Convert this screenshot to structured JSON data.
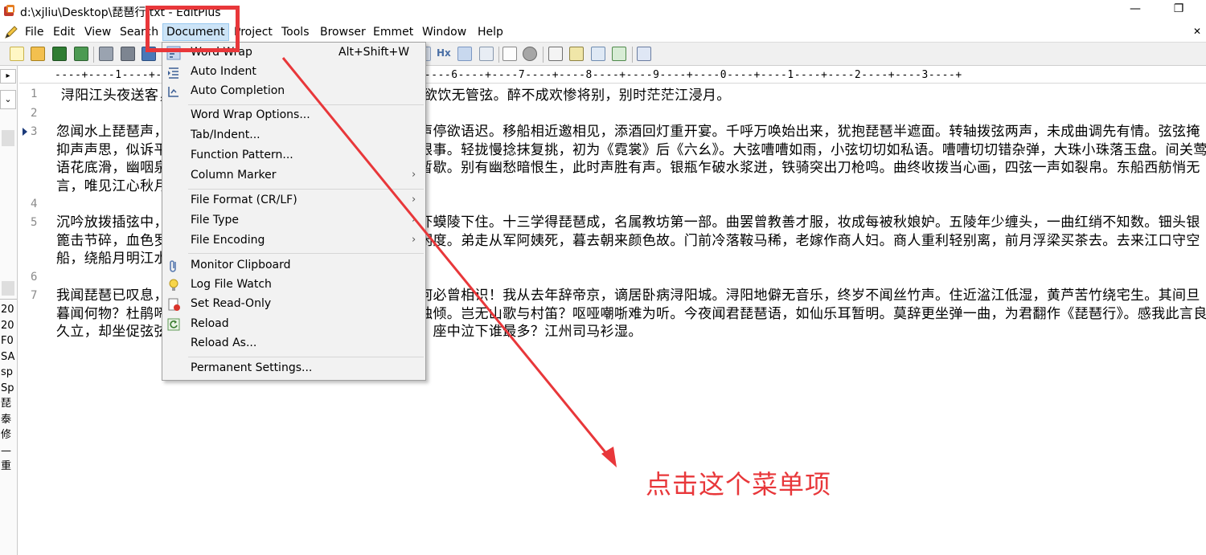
{
  "window": {
    "title": "d:\\xjliu\\Desktop\\琵琶行.txt - EditPlus",
    "minimize_glyph": "—",
    "maximize_glyph": "❐"
  },
  "menubar": {
    "items": [
      "File",
      "Edit",
      "View",
      "Search",
      "Document",
      "Project",
      "Tools",
      "Browser",
      "Emmet",
      "Window",
      "Help"
    ],
    "close_glyph": "✕"
  },
  "document_menu": {
    "items": [
      {
        "label": "Word Wrap",
        "shortcut": "Alt+Shift+W",
        "icon": "word-wrap-icon"
      },
      {
        "label": "Auto Indent",
        "icon": "auto-indent-icon"
      },
      {
        "label": "Auto Completion",
        "icon": "auto-completion-icon"
      },
      {
        "label": "Word Wrap Options..."
      },
      {
        "label": "Tab/Indent..."
      },
      {
        "label": "Function Pattern..."
      },
      {
        "label": "Column Marker",
        "submenu": true
      },
      {
        "label": "File Format (CR/LF)",
        "submenu": true
      },
      {
        "label": "File Type",
        "submenu": true
      },
      {
        "label": "File Encoding",
        "submenu": true
      },
      {
        "label": "Monitor Clipboard",
        "icon": "paperclip-icon"
      },
      {
        "label": "Log File Watch",
        "icon": "lightbulb-icon"
      },
      {
        "label": "Set Read-Only",
        "icon": "read-only-icon"
      },
      {
        "label": "Reload",
        "icon": "reload-icon"
      },
      {
        "label": "Reload As..."
      },
      {
        "label": "Permanent Settings..."
      }
    ],
    "submenu_glyph": "›"
  },
  "toolbar": {
    "hx_label": "Hx"
  },
  "ruler": {
    "text": "----+----1----+----2----+----3----+----4----+----5----+----6----+----7----+----8----+----9----+----0----+----1----+----2----+----3----+"
  },
  "sidepanel": {
    "arrow_glyph": "▸",
    "dropdown_glyph": "⌄",
    "entries": [
      "20",
      "20",
      "F0",
      "SA",
      "sp",
      "Sp",
      "琵",
      "泰",
      "修",
      "—",
      "重"
    ]
  },
  "editor": {
    "line_numbers": [
      "1",
      "2",
      "3",
      "4",
      "5",
      "6",
      "7"
    ],
    "paragraphs": [
      " 浔阳江头夜送客，枫叶荻花秋瑟瑟。主人下马客在船，举酒欲饮无管弦。醉不成欢惨将别，别时茫茫江浸月。",
      "忽闻水上琵琶声，主人忘归客不发。寻声暗问弹者谁，琵琶声停欲语迟。移船相近邀相见，添酒回灯重开宴。千呼万唤始出来，犹抱琵琶半遮面。转轴拨弦两声，未成曲调先有情。弦弦掩抑声声思，似诉平生不得志。低眉信手续续弹，说尽心中无限事。轻拢慢捻抹复挑，初为《霓裳》后《六幺》。大弦嘈嘈如雨，小弦切切如私语。嘈嘈切切错杂弹，大珠小珠落玉盘。间关莺语花底滑，幽咽泉流冰下难。冰泉冷涩弦凝绝，凝绝不通声暂歇。别有幽愁暗恨生，此时声胜有声。银瓶乍破水浆迸，铁骑突出刀枪鸣。曲终收拨当心画，四弦一声如裂帛。东船西舫悄无言，唯见江心秋月白。",
      "沉吟放拨插弦中，整顿衣裳起敛容。自言本是京城女，家在虾蟆陵下住。十三学得琵琶成，名属教坊第一部。曲罢曾教善才服，妆成每被秋娘妒。五陵年少缠头，一曲红绡不知数。钿头银篦击节碎，血色罗裙翻酒污。今年欢笑复明年，秋月春风等闲度。弟走从军阿姨死，暮去朝来颜色故。门前冷落鞍马稀，老嫁作商人妇。商人重利轻别离，前月浮梁买茶去。去来江口守空船，绕船月明江水寒。夜深忽梦少年事，梦啼妆泪红阑干。",
      "我闻琵琶已叹息，又闻此语重唧唧。同是天涯沦落人，相逢何必曾相识！我从去年辞帝京，谪居卧病浔阳城。浔阳地僻无音乐，终岁不闻丝竹声。住近湓江低湿，黄芦苦竹绕宅生。其间旦暮闻何物？杜鹃啼血猿哀鸣。春江花朝秋月夜，往往取酒还独倾。岂无山歌与村笛？呕哑嘲哳难为听。今夜闻君琵琶语，如仙乐耳暂明。莫辞更坐弹一曲，为君翻作《琵琶行》。感我此言良久立，却坐促弦弦转急。凄凄不似向前声，满座重闻皆掩泣。座中泣下谁最多？江州司马衫湿。"
    ]
  },
  "annotation": {
    "callout_text": "点击这个菜单项",
    "color": "#e8373a"
  }
}
